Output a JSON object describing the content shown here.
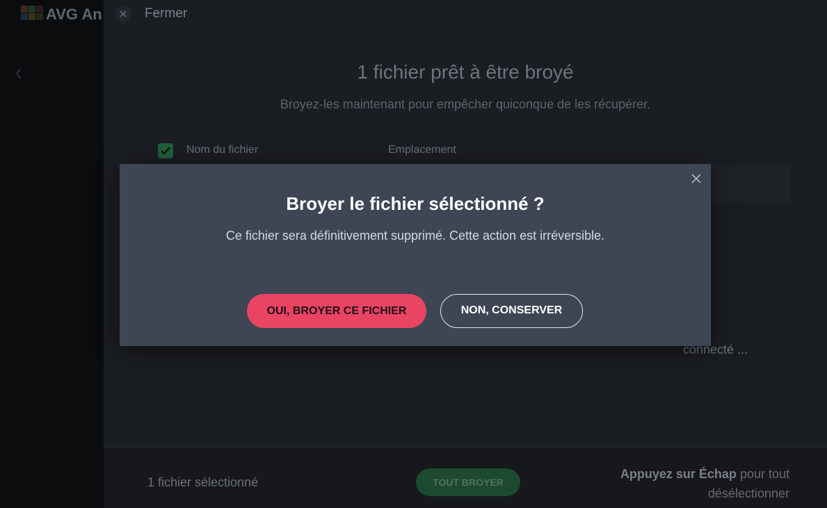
{
  "app": {
    "name": "AVG An"
  },
  "header": {
    "close_label": "Fermer"
  },
  "main": {
    "title": "1 fichier prêt à être broyé",
    "subtitle": "Broyez-les maintenant pour empêcher quiconque de les récupérer.",
    "table": {
      "headers": {
        "name": "Nom du fichier",
        "location": "Emplacement"
      },
      "rows": [
        {
          "location": "connecté ..."
        }
      ]
    }
  },
  "footer": {
    "selected_count": "1 fichier sélectionné",
    "shred_all_label": "TOUT BROYER",
    "hint_key": "Appuyez sur Échap",
    "hint_rest_1": " pour tout",
    "hint_rest_2": "désélectionner"
  },
  "dialog": {
    "title": "Broyer le fichier sélectionné ?",
    "message": "Ce fichier sera définitivement supprimé. Cette action est irréversible.",
    "confirm_label": "OUI, BROYER CE FICHIER",
    "cancel_label": "NON, CONSERVER"
  },
  "colors": {
    "accent": "#e94462",
    "dialog_bg": "#3e4555",
    "success": "#1f5f3a"
  }
}
